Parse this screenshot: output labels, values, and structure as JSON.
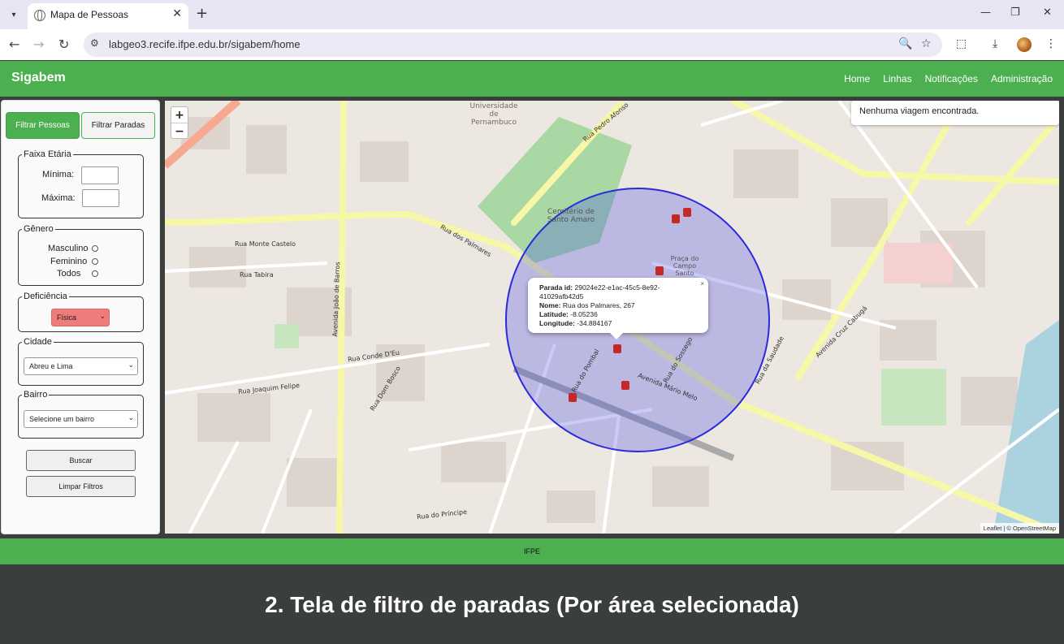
{
  "browser": {
    "tab_title": "Mapa de Pessoas",
    "url": "labgeo3.recife.ifpe.edu.br/sigabem/home"
  },
  "header": {
    "brand": "Sigabem",
    "nav": [
      "Home",
      "Linhas",
      "Notificações",
      "Administração"
    ]
  },
  "sidebar": {
    "tab_pessoas": "Filtrar Pessoas",
    "tab_paradas": "Filtrar Paradas",
    "faixa_etaria": {
      "legend": "Faixa Etária",
      "min_label": "Mínima:",
      "max_label": "Máxima:"
    },
    "genero": {
      "legend": "Gênero",
      "options": [
        "Masculino",
        "Feminino",
        "Todos"
      ]
    },
    "deficiencia": {
      "legend": "Deficiência",
      "selected": "Física"
    },
    "cidade": {
      "legend": "Cidade",
      "selected": "Abreu e Lima"
    },
    "bairro": {
      "legend": "Bairro",
      "selected": "Selecione um bairro"
    },
    "buscar": "Buscar",
    "limpar": "Limpar Filtros"
  },
  "map": {
    "zoom_in": "+",
    "zoom_out": "−",
    "notice": "Nenhuma viagem encontrada.",
    "popup": {
      "close": "×",
      "parada_label": "Parada id:",
      "parada_value": "29024e22-e1ac-45c5-8e92-41029afb42d5",
      "nome_label": "Nome:",
      "nome_value": "Rua dos Palmares, 267",
      "lat_label": "Latitude:",
      "lat_value": "-8.05236",
      "lon_label": "Longitude:",
      "lon_value": "-34.884167"
    },
    "labels": {
      "univ": "Universidade de Pernambuco",
      "cemiterio": "Cemitério de Santo Amaro",
      "rua_palmares": "Rua dos Palmares",
      "av_mario_melo": "Avenida Mário Melo",
      "av_joao_barros": "Avenida João de Barros",
      "rua_conde_eu": "Rua Conde D'Eu",
      "rua_joaquim_felipe": "Rua Joaquim Felipe",
      "rua_monte_castelo": "Rua Monte Castelo",
      "rua_tabira": "Rua Tabira",
      "rua_principe": "Rua do Príncipe",
      "rua_saudade": "Rua da Saudade",
      "rua_sossego": "Rua do Sossego",
      "rua_pombal": "Rua do Pombal",
      "av_cruz_cabuga": "Avenida Cruz Cabugá",
      "praca_campo_santo": "Praça do Campo Santo",
      "rua_dom_bosco": "Rua Dom Bosco",
      "rua_pedro_afonso": "Rua Pedro Afonso"
    },
    "attribution": "Leaflet | © OpenStreetMap"
  },
  "footer": "IFPE",
  "caption": "2. Tela de filtro de paradas (Por área selecionada)"
}
